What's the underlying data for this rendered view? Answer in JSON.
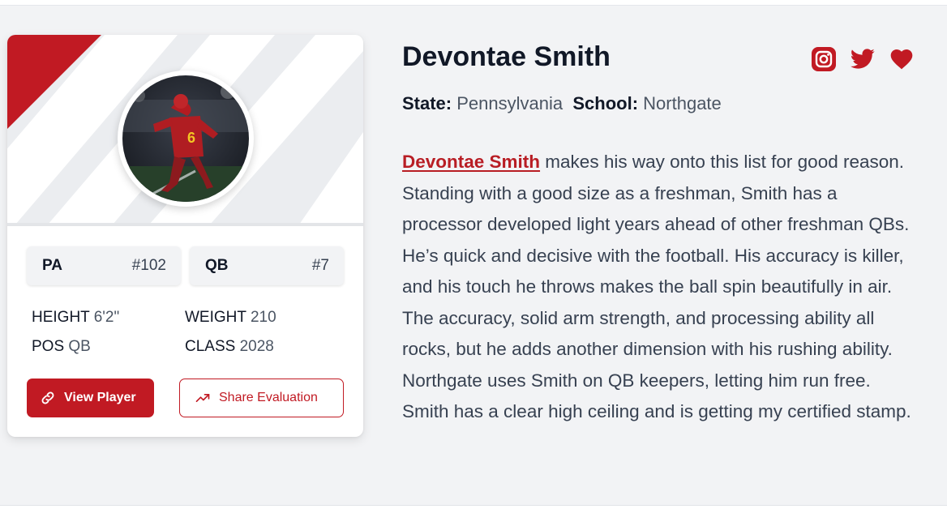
{
  "player": {
    "name": "Devontae Smith",
    "state_label": "State:",
    "state": "Pennsylvania",
    "school_label": "School:",
    "school": "Northgate",
    "bio_link": "Devontae Smith",
    "bio_text": " makes his way onto this list for good reason. Standing with a good size as a freshman, Smith has a processor developed light years ahead of other freshman QBs. He’s quick and decisive with the football. His accuracy is killer, and his touch he throws makes the ball spin beautifully in air. The accuracy, solid arm strength, and processing ability all rocks, but he adds another dimension with his rushing ability. Northgate uses Smith on QB keepers, letting him run free. Smith has a clear high ceiling and is getting my certified stamp."
  },
  "card": {
    "state_rank": {
      "label": "PA",
      "value": "#102"
    },
    "position_rank": {
      "label": "QB",
      "value": "#7"
    },
    "height": {
      "label": "HEIGHT",
      "value": "6'2\""
    },
    "weight": {
      "label": "WEIGHT",
      "value": "210"
    },
    "pos": {
      "label": "POS",
      "value": "QB"
    },
    "class": {
      "label": "CLASS",
      "value": "2028"
    },
    "view_button": "View Player",
    "share_button": "Share Evaluation",
    "jersey_number": "6"
  },
  "social": {
    "icons": [
      "instagram-icon",
      "twitter-icon",
      "heart-icon"
    ]
  },
  "colors": {
    "brand_red": "#c11a23",
    "panel_bg": "#f2f3f5",
    "text_dark": "#111827",
    "text_muted": "#4b5563"
  }
}
